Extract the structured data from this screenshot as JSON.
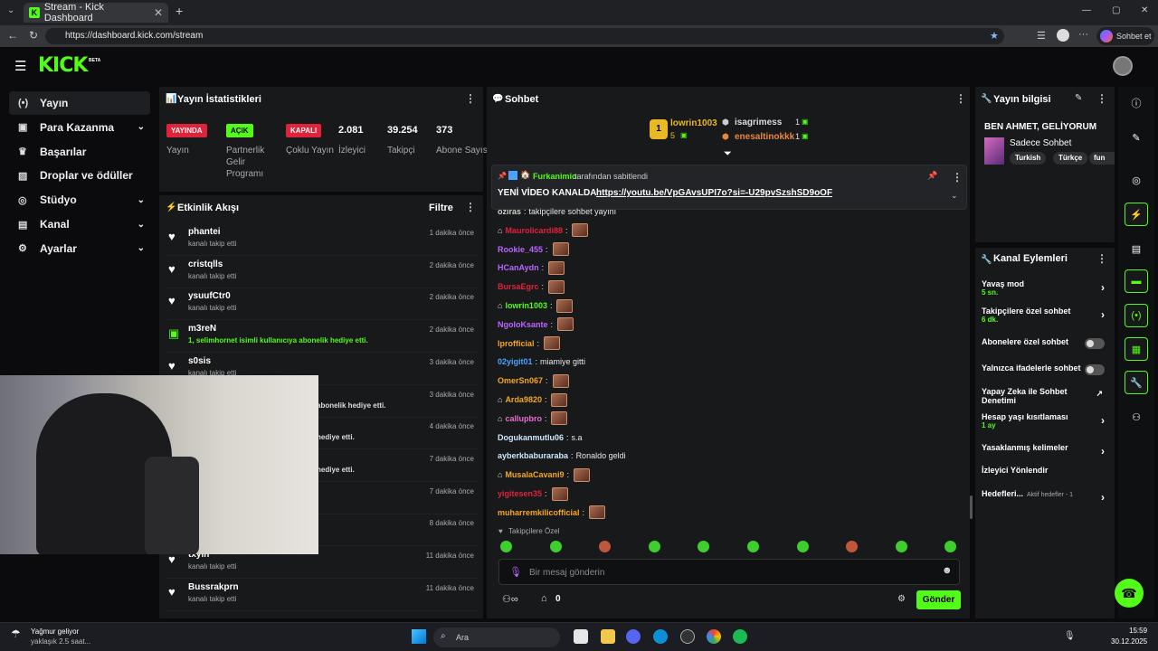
{
  "browser": {
    "tab_title": "Stream - Kick Dashboard",
    "url": "https://dashboard.kick.com/stream",
    "chat_button": "Sohbet et"
  },
  "header": {
    "logo": "KICK",
    "logo_badge": "BETA"
  },
  "sidebar": {
    "items": [
      {
        "label": "Yayın",
        "icon": "broadcast-icon",
        "expandable": false
      },
      {
        "label": "Para Kazanma",
        "icon": "money-icon",
        "expandable": true
      },
      {
        "label": "Başarılar",
        "icon": "trophy-icon",
        "expandable": false
      },
      {
        "label": "Droplar ve ödüller",
        "icon": "gift-icon",
        "expandable": false
      },
      {
        "label": "Stüdyo",
        "icon": "studio-icon",
        "expandable": true
      },
      {
        "label": "Kanal",
        "icon": "channel-icon",
        "expandable": true
      },
      {
        "label": "Ayarlar",
        "icon": "gear-icon",
        "expandable": true
      }
    ]
  },
  "stats": {
    "title": "Yayın İstatistikleri",
    "items": [
      {
        "badge": "YAYINDA",
        "label": "Yayın",
        "color": "#e0223a"
      },
      {
        "badge": "AÇIK",
        "label": "Partnerlik Gelir Programı",
        "color": "#53fc18"
      },
      {
        "badge": "KAPALI",
        "label": "Çoklu Yayın",
        "color": "#e0223a"
      },
      {
        "value": "2.081",
        "label": "İzleyici"
      },
      {
        "value": "39.254",
        "label": "Takipçi"
      },
      {
        "value": "373",
        "label": "Abone Sayısı"
      }
    ]
  },
  "activity": {
    "title": "Etkinlik Akışı",
    "filter": "Filtre",
    "rows": [
      {
        "name": "phantei",
        "sub": "kanalı takip etti",
        "time": "1 dakika önce",
        "icon": "heart-icon"
      },
      {
        "name": "cristqlls",
        "sub": "kanalı takip etti",
        "time": "2 dakika önce",
        "icon": "heart-icon"
      },
      {
        "name": "ysuufCtr0",
        "sub": "kanalı takip etti",
        "time": "2 dakika önce",
        "icon": "heart-icon"
      },
      {
        "name": "m3reN",
        "sub": "1, selimhornet isimli kullanıcıya abonelik hediye etti.",
        "time": "2 dakika önce",
        "icon": "gift-icon"
      },
      {
        "name": "s0sis",
        "sub": "kanalı takip etti",
        "time": "3 dakika önce",
        "icon": "heart-icon"
      },
      {
        "name": "",
        "sub": "abonelik hediye etti.",
        "time": "3 dakika önce",
        "icon": "gift-icon"
      },
      {
        "name": "",
        "sub": "hediye etti.",
        "time": "4 dakika önce",
        "icon": "gift-icon"
      },
      {
        "name": "",
        "sub": "hediye etti.",
        "time": "7 dakika önce",
        "icon": "gift-icon"
      },
      {
        "name": "",
        "sub": "",
        "time": "7 dakika önce",
        "icon": "heart-icon"
      },
      {
        "name": "",
        "sub": "",
        "time": "8 dakika önce",
        "icon": "heart-icon"
      },
      {
        "name": "txyih",
        "sub": "kanalı takip etti",
        "time": "11 dakika önce",
        "icon": "heart-icon"
      },
      {
        "name": "Bussrakprn",
        "sub": "kanalı takip etti",
        "time": "11 dakika önce",
        "icon": "heart-icon"
      }
    ]
  },
  "chat": {
    "title": "Sohbet",
    "top_gifters": [
      {
        "rank": "1",
        "name": "lowrin1003",
        "count": "5"
      },
      {
        "name": "isagrimess",
        "count": "1"
      },
      {
        "name": "enesaltinokkk",
        "count": "1"
      }
    ],
    "pinned_by": "Furkanimio",
    "pinned_suffix": "tarafından sabitlendi",
    "pinned_text": "YENİ VİDEO KANALDA :",
    "pinned_link": "https://youtu.be/VpGAvsUPI7o?si=-U29pvSzshSD9oOF",
    "messages": [
      {
        "user": "ozıras",
        "text": "takipçilere sohbet yayını",
        "color": "#cfcfcf",
        "emote": false
      },
      {
        "user": "Maurolicardi88",
        "text": "",
        "color": "#e0223a",
        "emote": true
      },
      {
        "user": "Rookie_455",
        "text": "",
        "color": "#b865ff",
        "emote": true
      },
      {
        "user": "HCanAydn",
        "text": "",
        "color": "#b865ff",
        "emote": true
      },
      {
        "user": "BursaEgrc",
        "text": "",
        "color": "#e0223a",
        "emote": true
      },
      {
        "user": "lowrin1003",
        "text": "",
        "color": "#53fc18",
        "emote": true
      },
      {
        "user": "NgoloKsante",
        "text": "",
        "color": "#b865ff",
        "emote": true
      },
      {
        "user": "lprofficial",
        "text": "",
        "color": "#f5a623",
        "emote": true
      },
      {
        "user": "02yigit01",
        "text": "miamiye gitti",
        "color": "#4aa3ff",
        "emote": false
      },
      {
        "user": "OmerSn067",
        "text": "",
        "color": "#f5a623",
        "emote": true
      },
      {
        "user": "Arda9820",
        "text": "",
        "color": "#f5a623",
        "emote": true
      },
      {
        "user": "callupbro",
        "text": "",
        "color": "#e86ccf",
        "emote": true
      },
      {
        "user": "Dogukanmutlu06",
        "text": "s.a",
        "color": "#cfe7ff",
        "emote": false
      },
      {
        "user": "ayberkbaburaraba",
        "text": "Ronaldo geldi",
        "color": "#cfe7ff",
        "emote": false
      },
      {
        "user": "MusalaCavani9",
        "text": "",
        "color": "#f5a623",
        "emote": true
      },
      {
        "user": "yigitesen35",
        "text": "",
        "color": "#e0223a",
        "emote": true
      },
      {
        "user": "muharremkilicofficial",
        "text": "",
        "color": "#f5a623",
        "emote": true
      }
    ],
    "followers_only": "Takipçilere Özel",
    "input_placeholder": "Bir mesaj gönderin",
    "points": "0",
    "send": "Gönder"
  },
  "stream_info": {
    "title": "Yayın bilgisi",
    "stream_title": "BEN AHMET, GELİYORUM",
    "category": "Sadece Sohbet",
    "tags": [
      "Turkish",
      "Türkçe",
      "fun"
    ]
  },
  "channel_actions": {
    "title": "Kanal Eylemleri",
    "items": [
      {
        "label": "Yavaş mod",
        "sub": "5 sn.",
        "control": "chevron"
      },
      {
        "label": "Takipçilere özel sohbet",
        "sub": "6 dk.",
        "control": "chevron"
      },
      {
        "label": "Abonelere özel sohbet",
        "sub": "",
        "control": "toggle"
      },
      {
        "label": "Yalnızca ifadelerle sohbet",
        "sub": "",
        "control": "toggle"
      },
      {
        "label": "Yapay Zeka ile Sohbet Denetimi",
        "sub": "",
        "control": "external"
      },
      {
        "label": "Hesap yaşı kısıtlaması",
        "sub": "1 ay",
        "control": "chevron"
      },
      {
        "label": "Yasaklanmış kelimeler",
        "sub": "",
        "control": "chevron"
      },
      {
        "label": "İzleyici Yönlendir",
        "sub": "",
        "control": "none"
      },
      {
        "label": "Hedefleri...",
        "sub": "Aktif hedefler - 1",
        "control": "chevron"
      }
    ]
  },
  "taskbar": {
    "weather_title": "Yağmur geliyor",
    "weather_sub": "yaklaşık 2.5 saat...",
    "search": "Ara",
    "time": "15:59",
    "date": "30.12.2025"
  }
}
